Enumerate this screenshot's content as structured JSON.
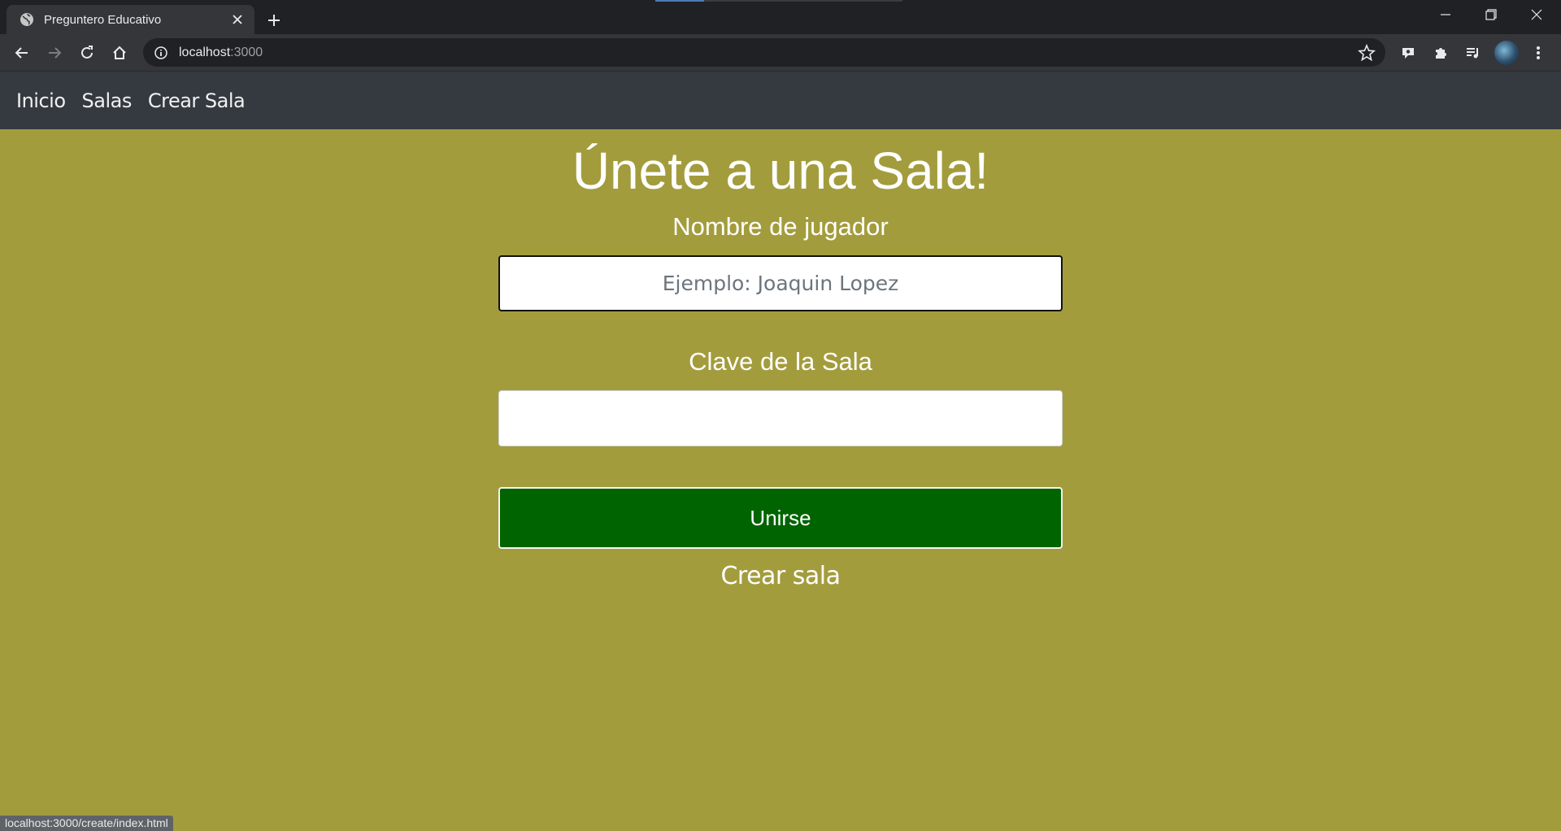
{
  "browser": {
    "tab_title": "Preguntero Educativo",
    "url_host": "localhost",
    "url_port": ":3000",
    "status_url": "localhost:3000/create/index.html"
  },
  "navbar": {
    "items": [
      {
        "label": "Inicio"
      },
      {
        "label": "Salas"
      },
      {
        "label": "Crear Sala"
      }
    ]
  },
  "form": {
    "heading": "Únete a una Sala!",
    "player_label": "Nombre de jugador",
    "player_placeholder": "Ejemplo: Joaquin Lopez",
    "player_value": "",
    "room_label": "Clave de la Sala",
    "room_value": "",
    "join_label": "Unirse",
    "create_link": "Crear sala"
  },
  "colors": {
    "page_bg": "#a39c3d",
    "navbar_bg": "#343a40",
    "join_button_bg": "#006400"
  },
  "icons": [
    "globe-icon",
    "close-icon",
    "plus-icon",
    "back-icon",
    "forward-icon",
    "reload-icon",
    "home-icon",
    "info-icon",
    "star-icon",
    "extension-icon",
    "puzzle-icon",
    "media-icon",
    "menu-icon"
  ]
}
